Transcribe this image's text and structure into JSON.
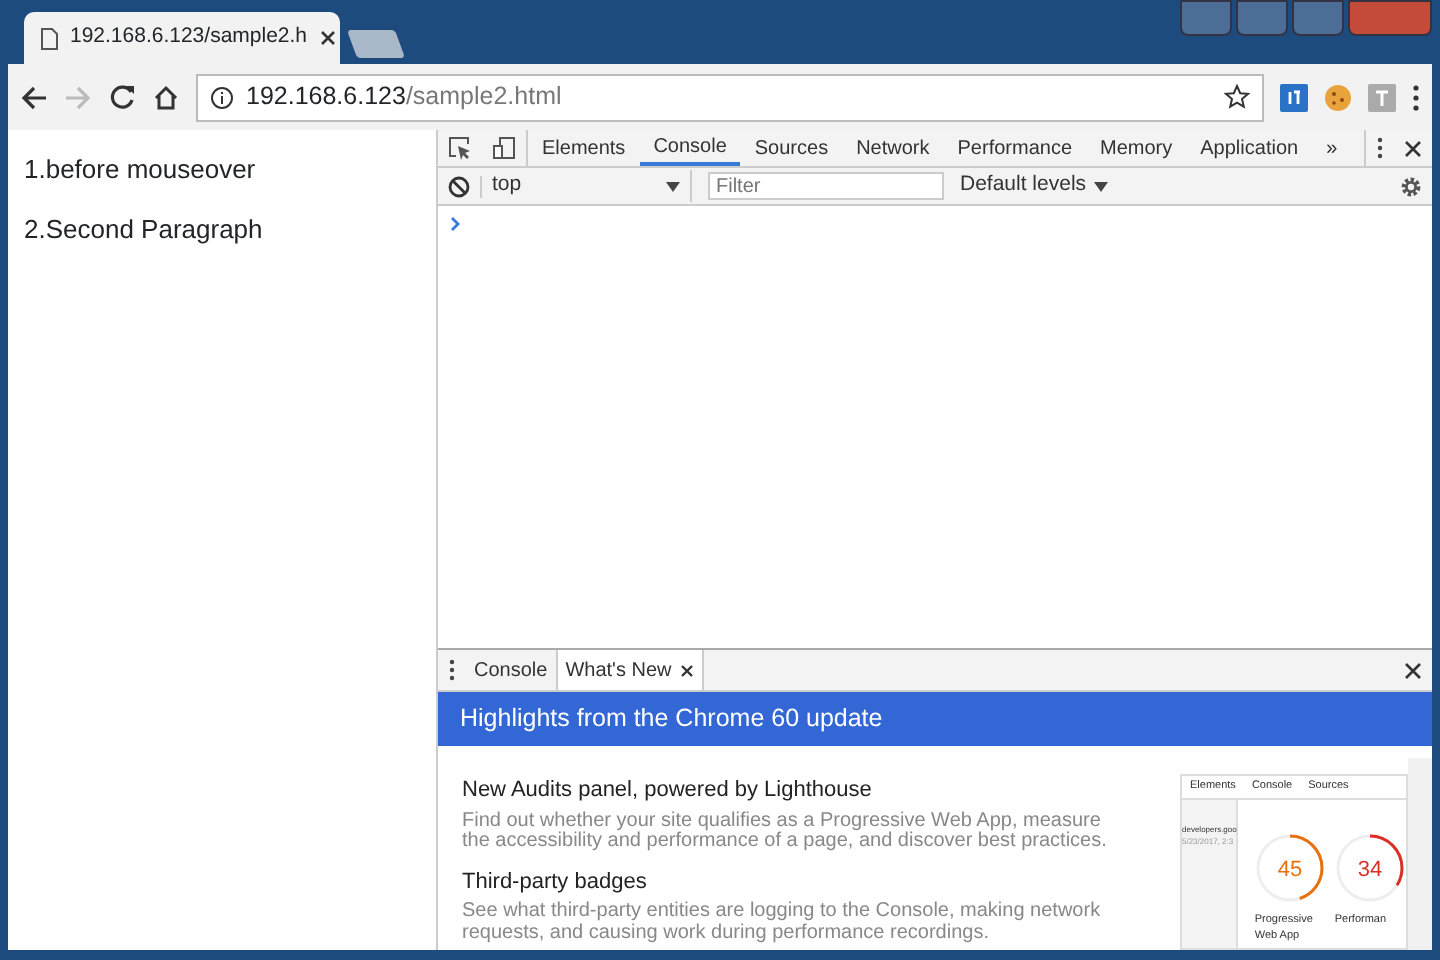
{
  "browser_tabs": [
    {
      "title": "192.168.6.123/sample2.h",
      "selected": true
    }
  ],
  "address": {
    "host": "192.168.6.123",
    "path": "/sample2.html"
  },
  "page": {
    "paragraphs": [
      "1.before mouseover",
      "2.Second Paragraph"
    ]
  },
  "devtools": {
    "panels": [
      {
        "label": "Elements",
        "selected": false
      },
      {
        "label": "Console",
        "selected": true
      },
      {
        "label": "Sources",
        "selected": false
      },
      {
        "label": "Network",
        "selected": false
      },
      {
        "label": "Performance",
        "selected": false
      },
      {
        "label": "Memory",
        "selected": false
      },
      {
        "label": "Application",
        "selected": false
      }
    ],
    "more": "»",
    "console_toolbar": {
      "context": "top",
      "filter_placeholder": "Filter",
      "levels": "Default levels"
    },
    "drawer": {
      "tabs": [
        {
          "label": "Console",
          "selected": false,
          "closable": false
        },
        {
          "label": "What's New",
          "selected": true,
          "closable": true
        }
      ],
      "banner": "Highlights from the Chrome 60 update",
      "items": [
        {
          "title": "New Audits panel, powered by Lighthouse",
          "body": "Find out whether your site qualifies as a Progressive Web App, measure the accessibility and performance of a page, and discover best practices."
        },
        {
          "title": "Third-party badges",
          "body": "See what third-party entities are logging to the Console, making network requests, and causing work during performance recordings."
        }
      ],
      "inset": {
        "tabs": [
          "Elements",
          "Console",
          "Sources"
        ],
        "entry": "developers.goo",
        "entry_date": "5/23/2017, 2:3",
        "scores": [
          {
            "value": "45",
            "label": "Progressive Web App",
            "color": "#e8710a",
            "level": 0.45
          },
          {
            "value": "34",
            "label": "Performan",
            "color": "#d93025",
            "level": 0.34
          }
        ]
      }
    }
  }
}
